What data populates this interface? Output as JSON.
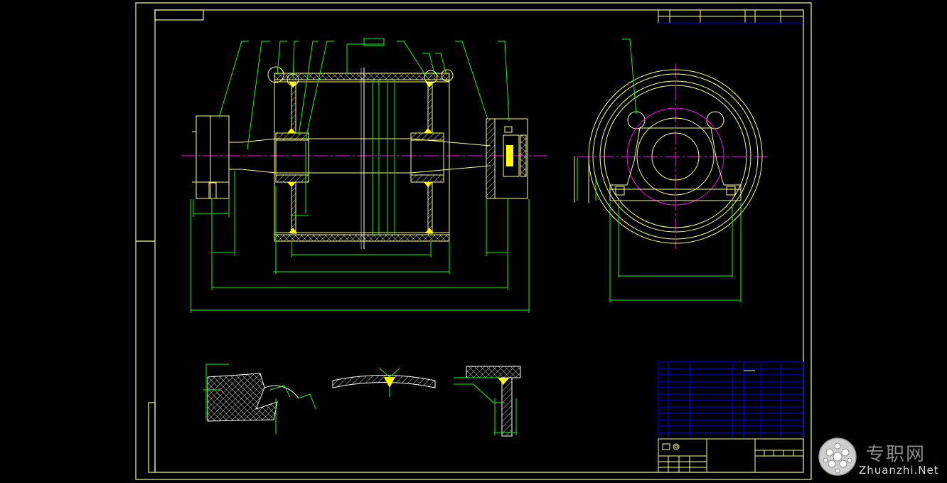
{
  "colors": {
    "background": "#000000",
    "frame": "#ffff80",
    "leader": "#00ff00",
    "centerline": "#ff00ff",
    "titleblock_grid": "#0000ff",
    "weld": "#ffff00",
    "detail": "#ffffff",
    "watermark": "#bbbbbb"
  },
  "watermark": {
    "chinese": "专职网",
    "english": "Zhuanzhi.Net",
    "logo_icon": "honeycomb-ball-icon"
  },
  "weld_symbols": [
    "weld-fillet-symbol",
    "weld-groove-symbol"
  ]
}
